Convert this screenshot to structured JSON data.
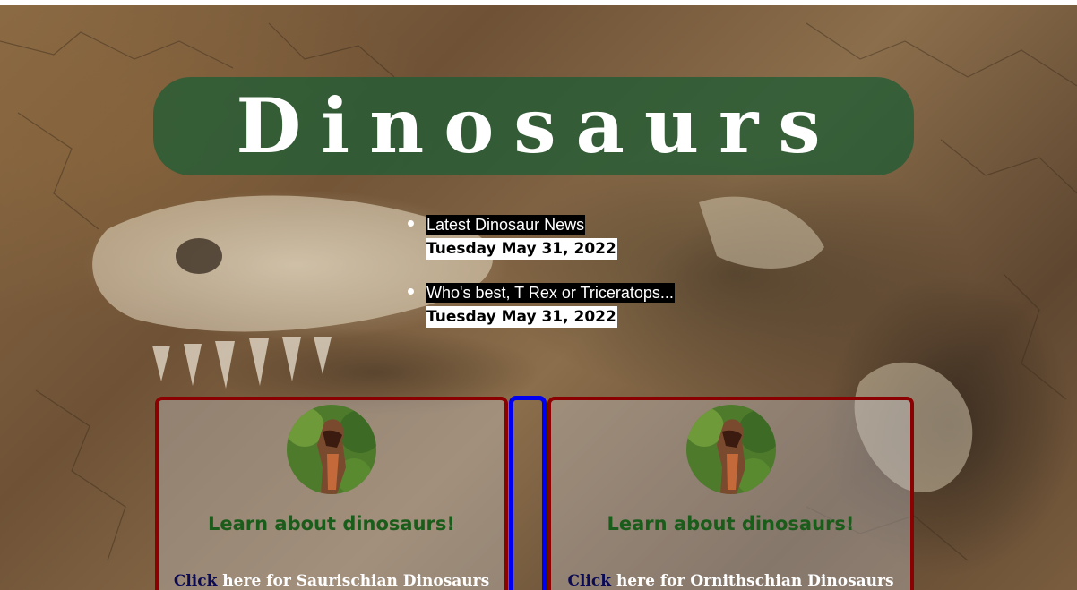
{
  "header": {
    "title": "Dinosaurs"
  },
  "news": [
    {
      "title": "Latest Dinosaur News",
      "date": "Tuesday May 31, 2022"
    },
    {
      "title": "Who's best, T Rex or Triceratops...",
      "date": "Tuesday May 31, 2022"
    }
  ],
  "cards": [
    {
      "heading": "Learn about dinosaurs!",
      "link_word": "Click",
      "link_rest": " here for Saurischian Dinosaurs"
    },
    {
      "heading": "Learn about dinosaurs!",
      "link_word": "Click",
      "link_rest": " here for Ornithschian Dinosaurs"
    }
  ],
  "colors": {
    "banner": "#205c34",
    "card_border": "#8b0000",
    "divider_border": "#0000ee",
    "heading_green": "#1a5c1a"
  }
}
